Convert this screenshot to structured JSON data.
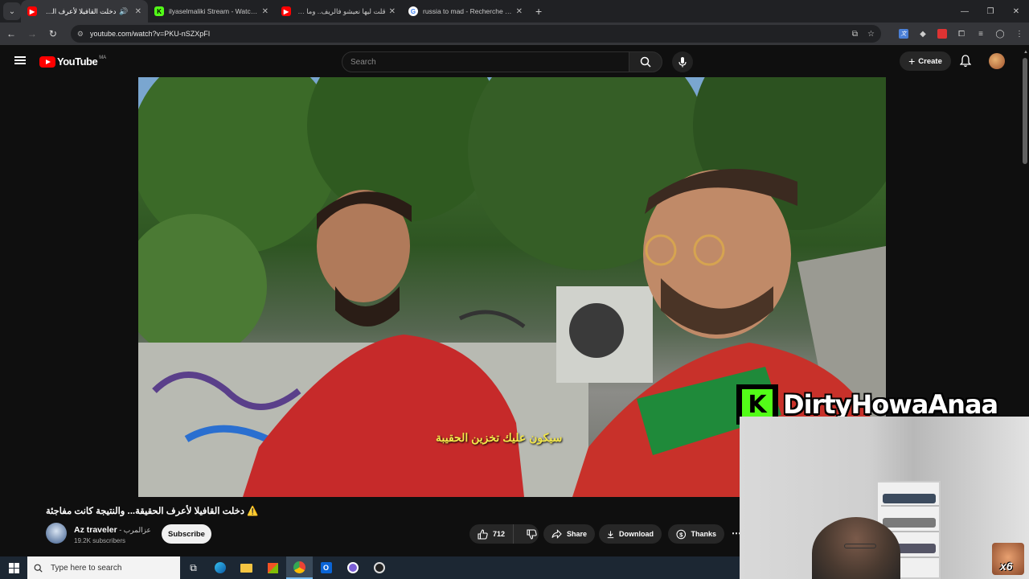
{
  "browser": {
    "tabs": [
      {
        "title": "دخلت القافيلا لأعرف الحقيقة...",
        "favicon": "youtube-icon",
        "active": true,
        "audio": true
      },
      {
        "title": "ilyaselmaliki Stream - Watch Live",
        "favicon": "kick-icon",
        "active": false
      },
      {
        "title": "قلت ليها نعيشو فالريف.. وما كنت...",
        "favicon": "youtube-icon",
        "active": false
      },
      {
        "title": "russia to mad - Recherche Google",
        "favicon": "google-icon",
        "active": false
      }
    ],
    "url": "youtube.com/watch?v=PKU-nSZXpFI"
  },
  "youtube": {
    "logo_text": "YouTube",
    "country_code": "MA",
    "search_placeholder": "Search",
    "create_label": "Create"
  },
  "video": {
    "subtitle": "سيكون عليك تخزين الحقيبة",
    "title": "⚠️ دخلت القافيلا لأعرف الحقيقة... والنتيجة كانت مفاجئة",
    "channel_name": "Az traveler",
    "channel_arabic": " - عزالمرب",
    "subscribers": "19.2K subscribers",
    "subscribe_label": "Subscribe",
    "likes": "712",
    "share_label": "Share",
    "download_label": "Download",
    "thanks_label": "Thanks"
  },
  "stream_overlay": {
    "streamer_name": "DirtyHowaAnaa",
    "platform_letter": "K",
    "emote_count": "x6"
  },
  "taskbar": {
    "search_placeholder": "Type here to search"
  },
  "colors": {
    "youtube_red": "#ff0000",
    "kick_green": "#53fc18",
    "subtitle_yellow": "#f2e64a"
  }
}
